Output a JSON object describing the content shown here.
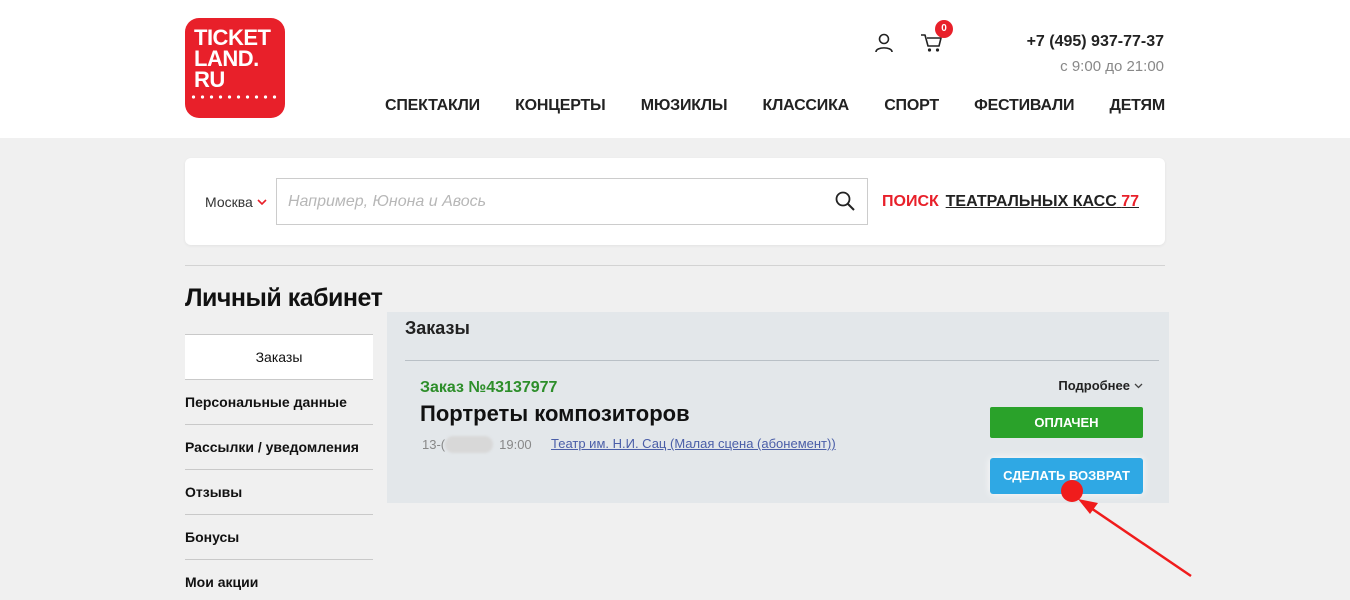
{
  "header": {
    "logo": {
      "line1": "TICKET",
      "line2": "LAND.",
      "line3": "RU"
    },
    "cart_count": "0",
    "phone": "+7 (495) 937-77-37",
    "hours": "с 9:00 до 21:00",
    "nav": [
      "СПЕКТАКЛИ",
      "КОНЦЕРТЫ",
      "МЮЗИКЛЫ",
      "КЛАССИКА",
      "СПОРТ",
      "ФЕСТИВАЛИ",
      "ДЕТЯМ"
    ]
  },
  "search": {
    "city": "Москва",
    "placeholder": "Например, Юнона и Авось",
    "button": "ПОИСК",
    "kassa_label": "ТЕАТРАЛЬНЫХ КАСС",
    "kassa_count": "77"
  },
  "sidebar": {
    "title": "Личный кабинет",
    "items": [
      "Заказы",
      "Персональные данные",
      "Рассылки / уведомления",
      "Отзывы",
      "Бонусы",
      "Мои акции"
    ]
  },
  "orders": {
    "title": "Заказы",
    "order": {
      "number": "Заказ №43137977",
      "name": "Портреты композиторов",
      "date_prefix": "13-(",
      "time": "19:00",
      "venue": "Театр им. Н.И. Сац (Малая сцена (абонемент))",
      "details": "Подробнее",
      "status": "ОПЛАЧЕН",
      "refund": "СДЕЛАТЬ ВОЗВРАТ"
    }
  },
  "colors": {
    "brand": "#e8202a",
    "paid": "#2aa22a",
    "refund": "#2fa8e4",
    "order_number": "#2d8e2a",
    "annotation": "#f01c1c"
  },
  "icons": [
    "user-icon",
    "cart-icon",
    "search-icon",
    "chevron-down-icon"
  ]
}
